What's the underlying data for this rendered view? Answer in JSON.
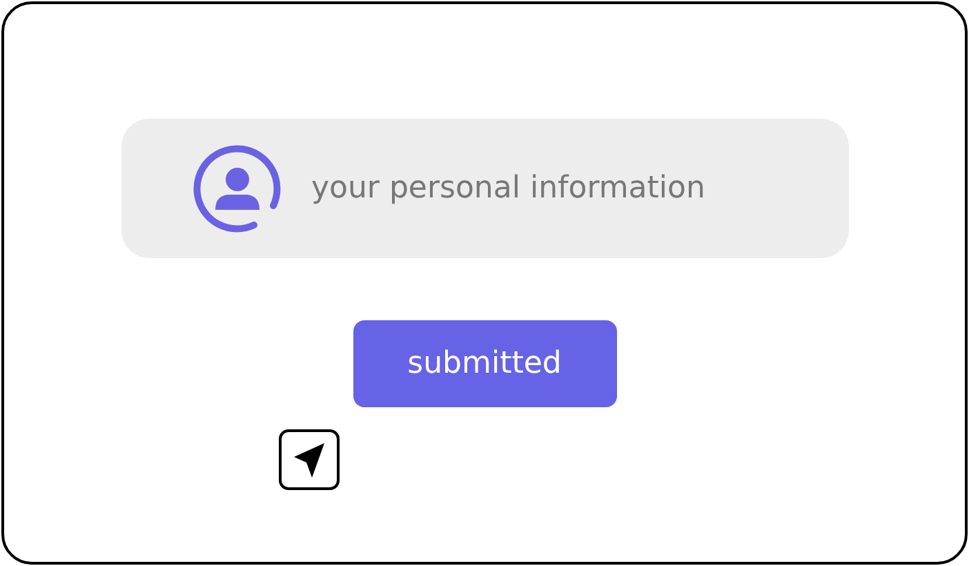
{
  "info_panel": {
    "text": "your personal information"
  },
  "button": {
    "label": "submitted"
  }
}
